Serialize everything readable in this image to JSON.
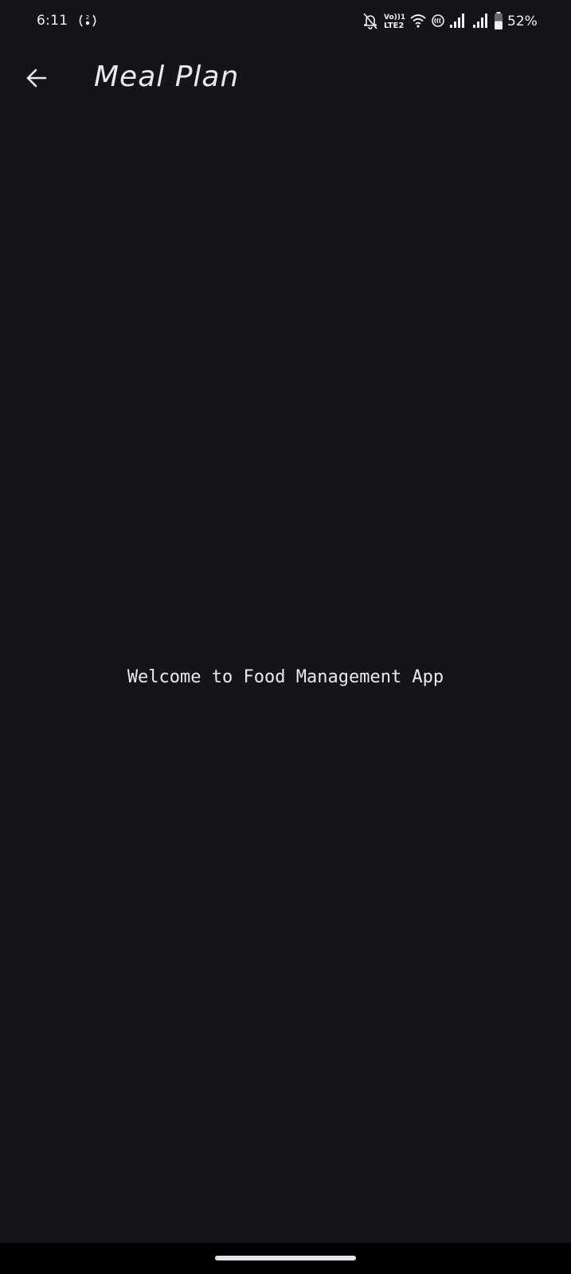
{
  "status_bar": {
    "time": "6:11",
    "battery_percent": "52%",
    "battery_level": 0.52,
    "volte_line1": "Vo))1",
    "volte_line2": "LTE2",
    "icons": [
      "hotspot-icon",
      "bell-off-icon",
      "volte-icon",
      "wifi-icon",
      "nfc-icon",
      "signal-icon",
      "signal-icon",
      "battery-icon"
    ]
  },
  "app_bar": {
    "back_icon": "arrow-left-icon",
    "title": "Meal Plan"
  },
  "main": {
    "welcome": "Welcome to Food Management App"
  },
  "colors": {
    "background": "#16131a",
    "text": "#ece8f1",
    "nav_bar": "#000000"
  }
}
